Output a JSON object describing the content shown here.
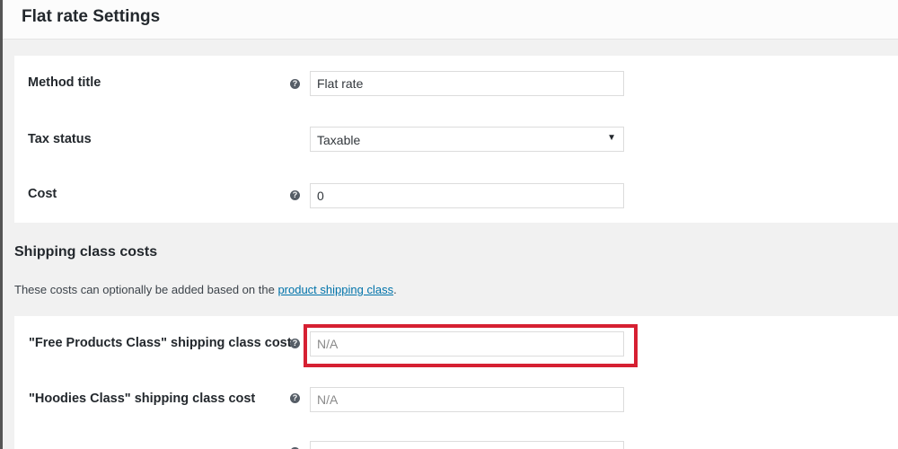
{
  "header": {
    "title": "Flat rate Settings"
  },
  "fields": {
    "method_title": {
      "label": "Method title",
      "value": "Flat rate"
    },
    "tax_status": {
      "label": "Tax status",
      "value": "Taxable"
    },
    "cost": {
      "label": "Cost",
      "value": "0"
    }
  },
  "shipping_class_costs": {
    "title": "Shipping class costs",
    "description_prefix": "These costs can optionally be added based on the ",
    "description_link": "product shipping class",
    "description_suffix": ".",
    "rows": [
      {
        "label": "\"Free Products Class\" shipping class cost",
        "placeholder": "N/A"
      },
      {
        "label": "\"Hoodies Class\" shipping class cost",
        "placeholder": "N/A"
      }
    ]
  },
  "icons": {
    "help": "?",
    "caret": "▼"
  },
  "colors": {
    "highlight": "#d62032",
    "link": "#0073aa"
  }
}
